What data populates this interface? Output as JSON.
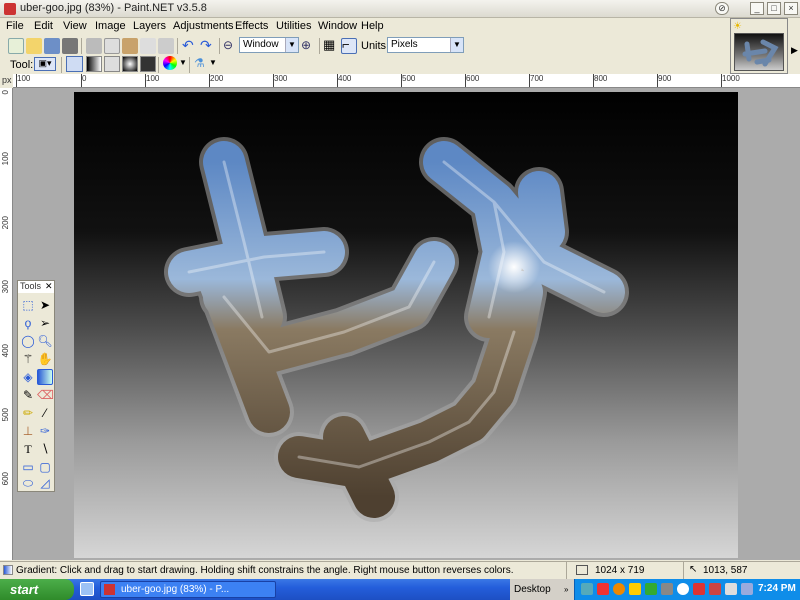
{
  "window": {
    "title": "uber-goo.jpg (83%) - Paint.NET v3.5.8"
  },
  "menu": [
    "File",
    "Edit",
    "View",
    "Image",
    "Layers",
    "Adjustments",
    "Effects",
    "Utilities",
    "Window",
    "Help"
  ],
  "toolbar": {
    "zoom_value": "Window",
    "units_label": "Units:",
    "units_value": "Pixels",
    "tool_label": "Tool:"
  },
  "ruler": {
    "unit": "px",
    "top_ticks": [
      "100",
      "0",
      "100",
      "200",
      "300",
      "400",
      "500",
      "600",
      "700",
      "800",
      "900",
      "1000"
    ],
    "left_ticks": [
      "0",
      "100",
      "200",
      "300",
      "400",
      "500",
      "600"
    ]
  },
  "tools_window": {
    "title": "Tools"
  },
  "status": {
    "hint": "Gradient: Click and drag to start drawing. Holding shift constrains the angle. Right mouse button reverses colors.",
    "image_size": "1024 x 719",
    "cursor_pos": "1013, 587"
  },
  "taskbar": {
    "start": "start",
    "task_item": "uber-goo.jpg (83%) - P...",
    "desktop": "Desktop",
    "clock": "7:24 PM"
  },
  "colors": {
    "titlebar": "#dcdad0",
    "taskbar": "#245edb",
    "tray": "#0f8de9",
    "start": "#2f8b2a",
    "canvas_top": "#000000",
    "canvas_bottom": "#d6d6d6"
  }
}
